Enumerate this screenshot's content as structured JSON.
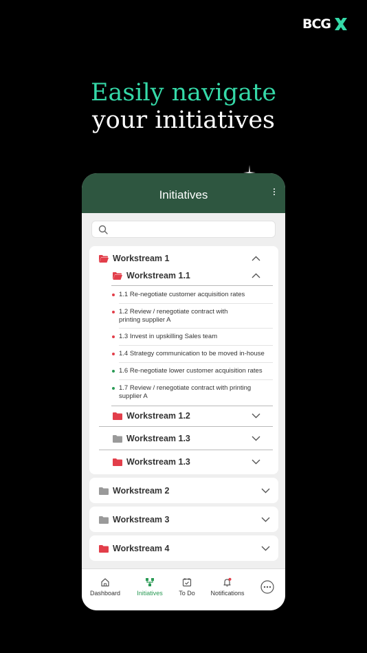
{
  "brand": {
    "name": "BCG",
    "x": "X"
  },
  "headline": {
    "line1": "Easily navigate",
    "line2": "your initiatives"
  },
  "app": {
    "title": "Initiatives",
    "search_placeholder": "",
    "colors": {
      "header": "#2e5640",
      "accent": "#2a9a55",
      "red": "#e23e4a",
      "green": "#2a9a55",
      "gray": "#9a9a9a"
    }
  },
  "tree": {
    "workstream1": {
      "label": "Workstream 1",
      "folder": "red-open",
      "expanded": true
    },
    "workstream1_1": {
      "label": "Workstream 1.1",
      "folder": "red-open",
      "expanded": true,
      "tasks": [
        {
          "text": "1.1 Re-negotiate customer acquisition rates",
          "status": "red"
        },
        {
          "text": "1.2 Review / renegotiate contract with printing supplier A",
          "status": "red"
        },
        {
          "text": "1.3 Invest in upskilling Sales team",
          "status": "red"
        },
        {
          "text": "1.4 Strategy communication to be moved in-house",
          "status": "red"
        },
        {
          "text": "1.6 Re-negotiate lower customer acquisition rates",
          "status": "green"
        },
        {
          "text": "1.7 Review / renegotiate contract with printing supplier A",
          "status": "green"
        }
      ]
    },
    "workstream1_2": {
      "label": "Workstream 1.2",
      "folder": "red"
    },
    "workstream1_3a": {
      "label": "Workstream 1.3",
      "folder": "gray"
    },
    "workstream1_3b": {
      "label": "Workstream 1.3",
      "folder": "red"
    },
    "workstream2": {
      "label": "Workstream 2",
      "folder": "gray"
    },
    "workstream3": {
      "label": "Workstream 3",
      "folder": "gray"
    },
    "workstream4": {
      "label": "Workstream 4",
      "folder": "red"
    }
  },
  "tabs": [
    {
      "label": "Dashboard",
      "icon": "home-icon"
    },
    {
      "label": "Initiatives",
      "icon": "hierarchy-icon",
      "active": true
    },
    {
      "label": "To Do",
      "icon": "calendar-check-icon"
    },
    {
      "label": "Notifications",
      "icon": "bell-icon"
    },
    {
      "label": "",
      "icon": "more-horizontal-icon"
    }
  ]
}
